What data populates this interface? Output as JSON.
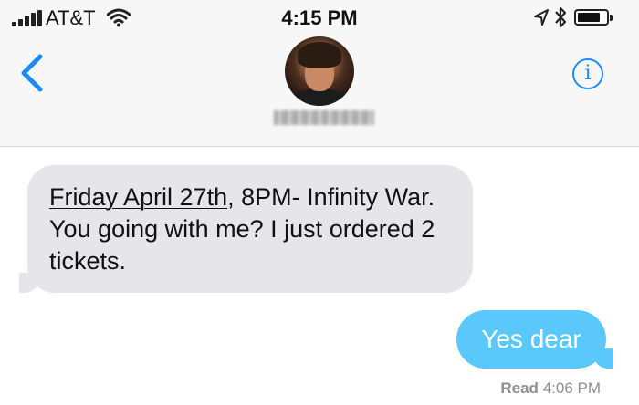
{
  "status_bar": {
    "carrier": "AT&T",
    "time": "4:15 PM"
  },
  "nav": {
    "contact_name": "",
    "info_glyph": "i"
  },
  "icons": [
    "signal-icon",
    "wifi-icon",
    "location-arrow-icon",
    "bluetooth-icon",
    "battery-icon",
    "back-chevron-icon",
    "info-icon"
  ],
  "colors": {
    "accent": "#1e8cf5",
    "incoming_bubble": "#e5e5ea",
    "outgoing_bubble": "#5ac8fa",
    "receipt_text": "#8e8e93"
  },
  "messages": {
    "incoming": {
      "link_text": "Friday April 27th",
      "text_rest": ", 8PM- Infinity War. You going with me? I just ordered 2 tickets."
    },
    "outgoing": {
      "text": "Yes dear"
    }
  },
  "receipt": {
    "label": "Read",
    "time": "4:06 PM"
  }
}
